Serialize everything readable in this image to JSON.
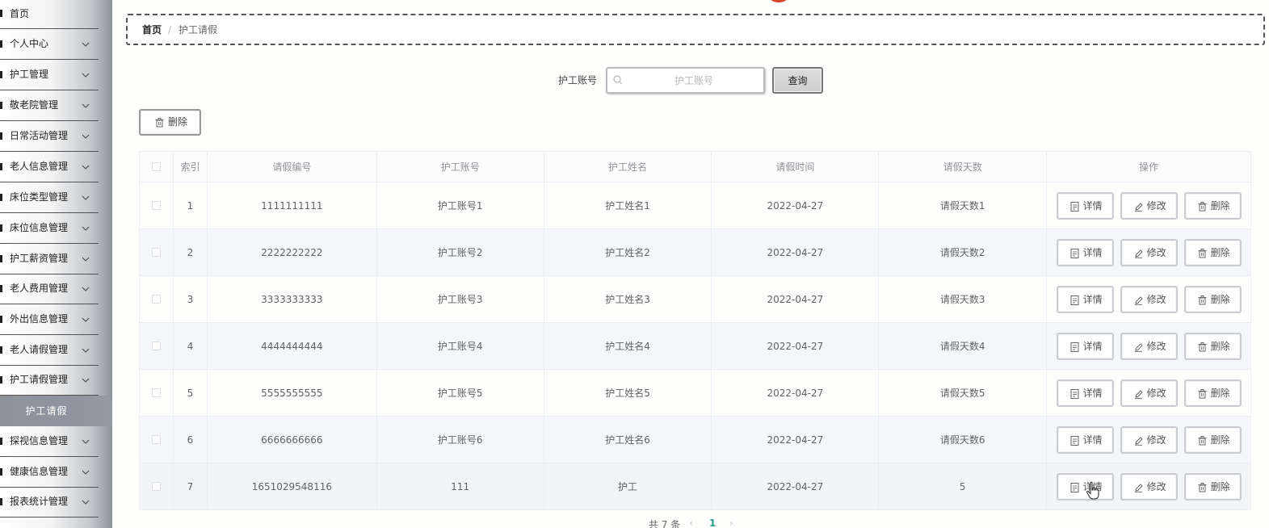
{
  "sidebar": {
    "items": [
      {
        "label": "首页"
      },
      {
        "label": "个人中心"
      },
      {
        "label": "护工管理"
      },
      {
        "label": "敬老院管理"
      },
      {
        "label": "日常活动管理"
      },
      {
        "label": "老人信息管理"
      },
      {
        "label": "床位类型管理"
      },
      {
        "label": "床位信息管理"
      },
      {
        "label": "护工薪资管理"
      },
      {
        "label": "老人费用管理"
      },
      {
        "label": "外出信息管理"
      },
      {
        "label": "老人请假管理"
      },
      {
        "label": "护工请假管理"
      },
      {
        "label": "探视信息管理"
      },
      {
        "label": "健康信息管理"
      },
      {
        "label": "报表统计管理"
      }
    ],
    "active_sub": "护工请假"
  },
  "breadcrumb": {
    "home": "首页",
    "separator": "/",
    "current": "护工请假"
  },
  "search": {
    "label": "护工账号",
    "placeholder": "护工账号",
    "button": "查询"
  },
  "toolbar": {
    "delete_label": "删除"
  },
  "table": {
    "headers": [
      "索引",
      "请假编号",
      "护工账号",
      "护工姓名",
      "请假时间",
      "请假天数",
      "操作"
    ],
    "rows": [
      {
        "index": "1",
        "leave_no": "1111111111",
        "account": "护工账号1",
        "name": "护工姓名1",
        "date": "2022-04-27",
        "days": "请假天数1"
      },
      {
        "index": "2",
        "leave_no": "2222222222",
        "account": "护工账号2",
        "name": "护工姓名2",
        "date": "2022-04-27",
        "days": "请假天数2"
      },
      {
        "index": "3",
        "leave_no": "3333333333",
        "account": "护工账号3",
        "name": "护工姓名3",
        "date": "2022-04-27",
        "days": "请假天数3"
      },
      {
        "index": "4",
        "leave_no": "4444444444",
        "account": "护工账号4",
        "name": "护工姓名4",
        "date": "2022-04-27",
        "days": "请假天数4"
      },
      {
        "index": "5",
        "leave_no": "5555555555",
        "account": "护工账号5",
        "name": "护工姓名5",
        "date": "2022-04-27",
        "days": "请假天数5"
      },
      {
        "index": "6",
        "leave_no": "6666666666",
        "account": "护工账号6",
        "name": "护工姓名6",
        "date": "2022-04-27",
        "days": "请假天数6"
      },
      {
        "index": "7",
        "leave_no": "1651029548116",
        "account": "111",
        "name": "护工",
        "date": "2022-04-27",
        "days": "5"
      }
    ],
    "actions": {
      "detail": "详情",
      "edit": "修改",
      "delete": "删除"
    }
  },
  "pagination": {
    "total": "共 7 条",
    "prev": "‹",
    "page": "1",
    "next": "›"
  },
  "colors": {
    "accent": "#2a9d8f",
    "logo": "#d9472b"
  }
}
